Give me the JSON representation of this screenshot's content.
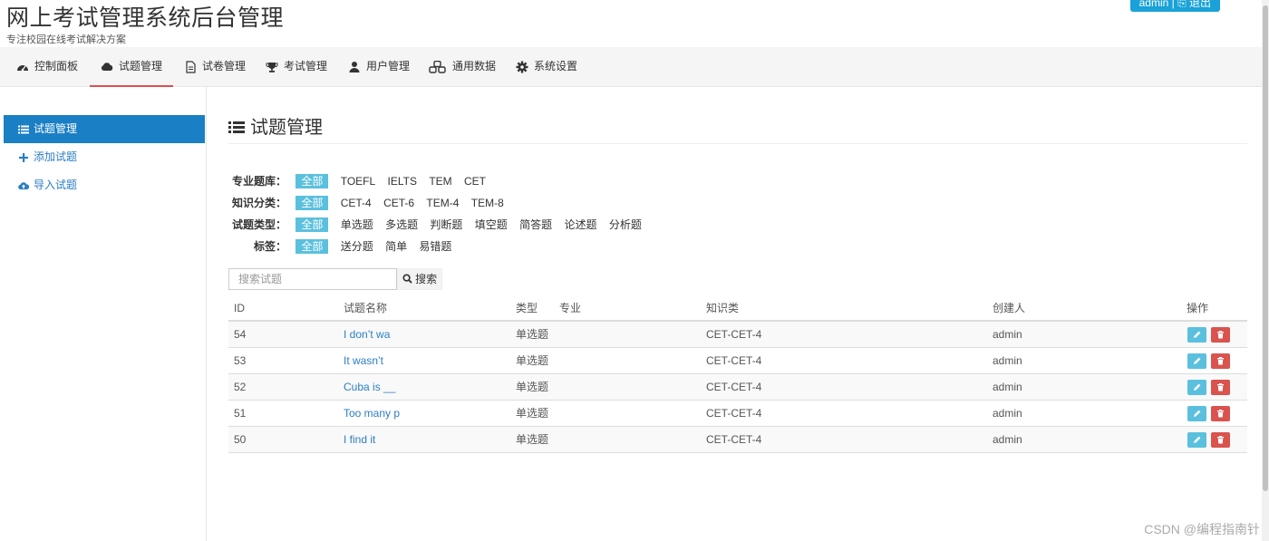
{
  "app": {
    "title": "网上考试管理系统后台管理",
    "subtitle": "专注校园在线考试解决方案",
    "user_button": "admin | ⎘ 退出"
  },
  "topnav": [
    {
      "label": "控制面板",
      "icon": "dashboard-icon"
    },
    {
      "label": "试题管理",
      "icon": "cloud-icon",
      "active": true
    },
    {
      "label": "试卷管理",
      "icon": "file-icon"
    },
    {
      "label": "考试管理",
      "icon": "trophy-icon"
    },
    {
      "label": "用户管理",
      "icon": "user-icon"
    },
    {
      "label": "通用数据",
      "icon": "cubes-icon"
    },
    {
      "label": "系统设置",
      "icon": "gear-icon"
    }
  ],
  "sidebar": [
    {
      "label": "试题管理",
      "icon": "list-icon",
      "active": true
    },
    {
      "label": "添加试题",
      "icon": "plus-icon"
    },
    {
      "label": "导入试题",
      "icon": "cloud-upload-icon"
    }
  ],
  "main": {
    "title": "试题管理",
    "filters": [
      {
        "label": "专业题库：",
        "options": [
          "全部",
          "TOEFL",
          "IELTS",
          "TEM",
          "CET"
        ]
      },
      {
        "label": "知识分类：",
        "options": [
          "全部",
          "CET-4",
          "CET-6",
          "TEM-4",
          "TEM-8"
        ]
      },
      {
        "label": "试题类型：",
        "options": [
          "全部",
          "单选题",
          "多选题",
          "判断题",
          "填空题",
          "简答题",
          "论述题",
          "分析题"
        ]
      },
      {
        "label": "标签：",
        "options": [
          "全部",
          "送分题",
          "简单",
          "易错题"
        ]
      }
    ],
    "search": {
      "placeholder": "搜索试题",
      "button": "搜索"
    },
    "table": {
      "headers": [
        "ID",
        "试题名称",
        "类型",
        "专业",
        "知识类",
        "创建人",
        "操作"
      ],
      "rows": [
        {
          "id": "54",
          "name": "I don’t wa",
          "type": "单选题",
          "major": "",
          "knowledge": "CET-CET-4",
          "creator": "admin"
        },
        {
          "id": "53",
          "name": "It wasn’t",
          "type": "单选题",
          "major": "",
          "knowledge": "CET-CET-4",
          "creator": "admin"
        },
        {
          "id": "52",
          "name": "Cuba is __",
          "type": "单选题",
          "major": "",
          "knowledge": "CET-CET-4",
          "creator": "admin"
        },
        {
          "id": "51",
          "name": "Too many p",
          "type": "单选题",
          "major": "",
          "knowledge": "CET-CET-4",
          "creator": "admin"
        },
        {
          "id": "50",
          "name": "I find it",
          "type": "单选题",
          "major": "",
          "knowledge": "CET-CET-4",
          "creator": "admin"
        }
      ]
    }
  },
  "watermark": "CSDN @编程指南针",
  "colors": {
    "accent": "#1a7fc4",
    "selected_tag": "#5bc0de",
    "edit": "#5bc0de",
    "delete": "#d9534f",
    "active_underline": "#e24e4e"
  }
}
